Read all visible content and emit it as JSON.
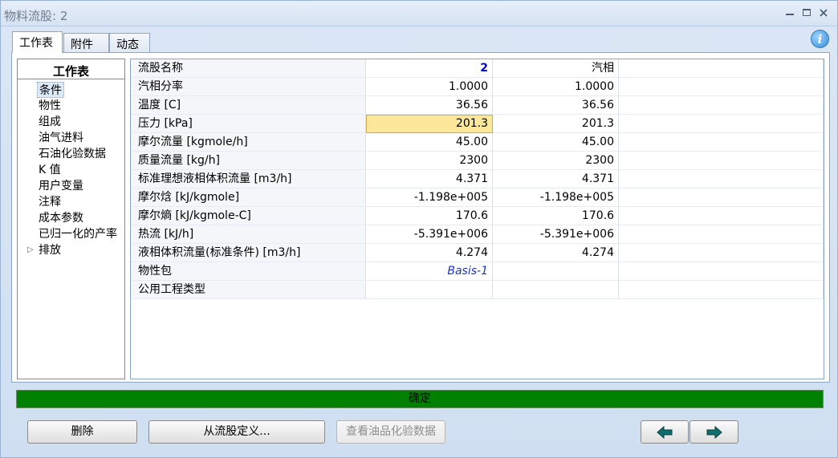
{
  "window": {
    "title": "物料流股: 2"
  },
  "tabs": [
    {
      "label": "工作表",
      "active": true
    },
    {
      "label": "附件",
      "active": false
    },
    {
      "label": "动态",
      "active": false
    }
  ],
  "nav": {
    "header": "工作表",
    "items": [
      {
        "label": "条件",
        "selected": true
      },
      {
        "label": "物性"
      },
      {
        "label": "组成"
      },
      {
        "label": "油气进料"
      },
      {
        "label": "石油化验数据"
      },
      {
        "label": "K 值"
      },
      {
        "label": "用户变量"
      },
      {
        "label": "注释"
      },
      {
        "label": "成本参数"
      },
      {
        "label": "已归一化的产率"
      },
      {
        "label": "排放",
        "expandable": true
      }
    ]
  },
  "grid": {
    "rows": [
      {
        "name": "流股名称",
        "v1": "2",
        "v2": "汽相",
        "v3": ""
      },
      {
        "name": "汽相分率",
        "v1": "1.0000",
        "v2": "1.0000",
        "v3": ""
      },
      {
        "name": "温度 [C]",
        "v1": "36.56",
        "v2": "36.56",
        "v3": ""
      },
      {
        "name": "压力 [kPa]",
        "v1": "201.3",
        "v2": "201.3",
        "v3": ""
      },
      {
        "name": "摩尔流量 [kgmole/h]",
        "v1": "45.00",
        "v2": "45.00",
        "v3": ""
      },
      {
        "name": "质量流量 [kg/h]",
        "v1": "2300",
        "v2": "2300",
        "v3": ""
      },
      {
        "name": "标准理想液相体积流量 [m3/h]",
        "v1": "4.371",
        "v2": "4.371",
        "v3": ""
      },
      {
        "name": "摩尔焓 [kJ/kgmole]",
        "v1": "-1.198e+005",
        "v2": "-1.198e+005",
        "v3": ""
      },
      {
        "name": "摩尔熵 [kJ/kgmole-C]",
        "v1": "170.6",
        "v2": "170.6",
        "v3": ""
      },
      {
        "name": "热流 [kJ/h]",
        "v1": "-5.391e+006",
        "v2": "-5.391e+006",
        "v3": ""
      },
      {
        "name": "液相体积流量(标准条件) [m3/h]",
        "v1": "4.274",
        "v2": "4.274",
        "v3": ""
      },
      {
        "name": "物性包",
        "v1": "Basis-1",
        "v2": "",
        "v3": ""
      },
      {
        "name": "公用工程类型",
        "v1": "",
        "v2": "",
        "v3": ""
      }
    ]
  },
  "status": {
    "text": "确定",
    "color": "#008000"
  },
  "buttons": {
    "delete": "删除",
    "define_from_stream": "从流股定义...",
    "view_assay": "查看油品化验数据"
  },
  "icons": {
    "info": "info-icon",
    "prev": "arrow-left-icon",
    "next": "arrow-right-icon"
  }
}
